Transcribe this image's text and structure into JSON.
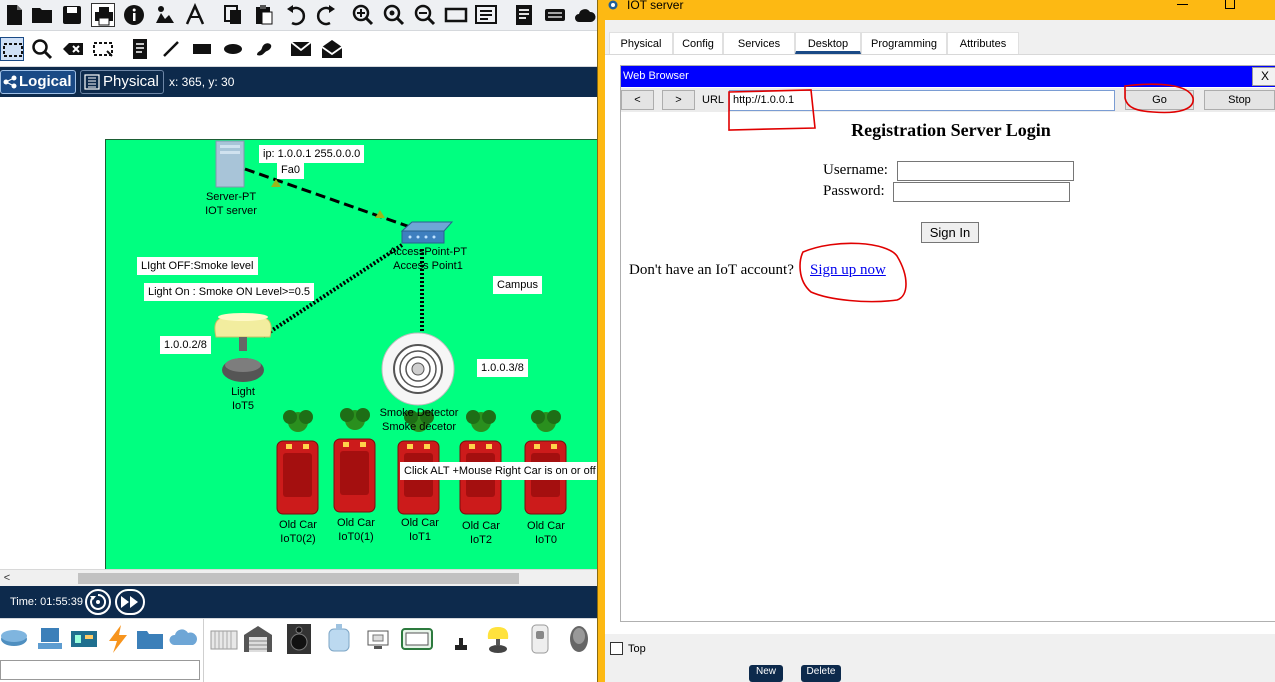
{
  "toolbar": {
    "icons": [
      "new-file-icon",
      "open-folder-icon",
      "save-icon",
      "print-icon",
      "info-icon",
      "network-wizard-icon",
      "activity-wizard-icon",
      "copy-icon",
      "paste-icon",
      "undo-icon",
      "redo-icon",
      "zoom-in-icon",
      "zoom-reset-icon",
      "zoom-out-icon",
      "drawing-palette-icon",
      "custom-device-icon",
      "text-file-icon",
      "router-icon",
      "cloud-icon"
    ]
  },
  "toolbar2": {
    "icons": [
      "select-icon",
      "inspect-icon",
      "delete-icon",
      "resize-icon",
      "note-icon",
      "line-icon",
      "rectangle-icon",
      "ellipse-icon",
      "freeform-icon",
      "add-pdu-icon",
      "add-complex-pdu-icon"
    ]
  },
  "modebar": {
    "logical_label": "Logical",
    "physical_label": "Physical",
    "coords": "x: 365, y: 30"
  },
  "canvas": {
    "notes": {
      "ip": "ip: 1.0.0.1 255.0.0.0",
      "fa0": "Fa0",
      "light_off": "LIght OFF:Smoke level",
      "light_on": "Light On : Smoke ON Level>=0.5",
      "campus": "Campus",
      "light_ip": "1.0.0.2/8",
      "smoke_ip": "1.0.0.3/8",
      "car_hint": "Click ALT +Mouse Right Car is on or off"
    },
    "devices": {
      "server_line1": "Server-PT",
      "server_line2": "IOT server",
      "ap_line1": "AccessPoint-PT",
      "ap_line2": "Access Point1",
      "light_line1": "Light",
      "light_line2": "IoT5",
      "smoke_line1": "Smoke Detector",
      "smoke_line2": "Smoke decetor",
      "cars": [
        {
          "line1": "Old Car",
          "line2": "IoT0(2)"
        },
        {
          "line1": "Old Car",
          "line2": "IoT0(1)"
        },
        {
          "line1": "Old Car",
          "line2": "IoT1"
        },
        {
          "line1": "Old Car",
          "line2": "IoT2"
        },
        {
          "line1": "Old Car",
          "line2": "IoT0"
        }
      ]
    }
  },
  "scrollbar": {
    "left_arrow": "<"
  },
  "timebar": {
    "time": "Time: 01:55:39"
  },
  "iot_window": {
    "title": "IOT server",
    "tabs": [
      "Physical",
      "Config",
      "Services",
      "Desktop",
      "Programming",
      "Attributes"
    ],
    "active_tab": "Desktop",
    "browser": {
      "title": "Web Browser",
      "close": "X",
      "back": "<",
      "forward": ">",
      "url_label": "URL",
      "url_value": "http://1.0.0.1",
      "go": "Go",
      "stop": "Stop",
      "page": {
        "heading": "Registration Server Login",
        "username_label": "Username:",
        "password_label": "Password:",
        "signin": "Sign In",
        "account_prompt": "Don't have an IoT account?",
        "signup_link": "Sign up now"
      }
    },
    "top_label": "Top"
  },
  "bottom_strip": {
    "new": "New",
    "delete": "Delete"
  },
  "colors": {
    "workspace": "#00ff80",
    "navy": "#0d2a4c",
    "window_frame": "#fdb913",
    "browser_title": "#0000ff",
    "annotation": "#e00000"
  }
}
